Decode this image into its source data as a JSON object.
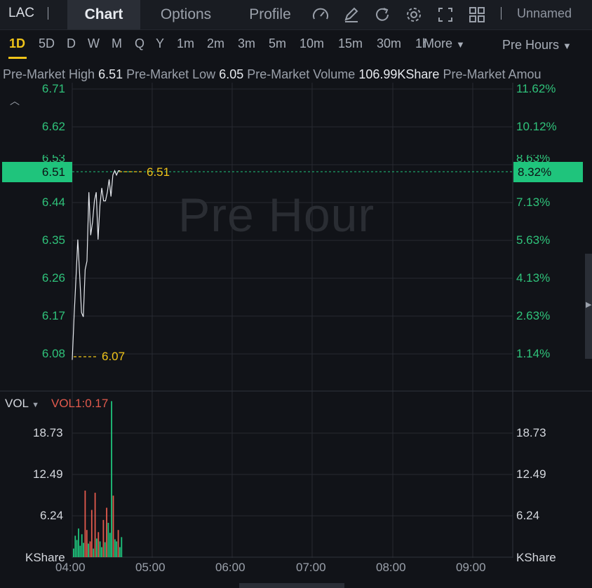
{
  "symbol": "LAC",
  "tabs": [
    "Chart",
    "Options",
    "Profile"
  ],
  "toolbar_icons": [
    "gauge-icon",
    "edit-icon",
    "refresh-icon",
    "settings-icon",
    "fullscreen-icon",
    "layout-grid-icon"
  ],
  "layout_name": "Unnamed",
  "periods": [
    "1D",
    "5D",
    "D",
    "W",
    "M",
    "Q",
    "Y",
    "1m",
    "2m",
    "3m",
    "5m",
    "10m",
    "15m",
    "30m",
    "1h"
  ],
  "more_label": "More",
  "session_label": "Pre Hours",
  "stats": {
    "high_label": "Pre-Market High",
    "high_value": "6.51",
    "low_label": "Pre-Market Low",
    "low_value": "6.05",
    "volume_label": "Pre-Market Volume",
    "volume_value": "106.99KShare",
    "amount_label": "Pre-Market Amou"
  },
  "watermark": "Pre Hour",
  "price_axis": [
    "6.71",
    "6.62",
    "6.53",
    "6.44",
    "6.35",
    "6.26",
    "6.17",
    "6.08"
  ],
  "pct_axis": [
    "11.62%",
    "10.12%",
    "8.63%",
    "7.13%",
    "5.63%",
    "4.13%",
    "2.63%",
    "1.14%"
  ],
  "current_price": "6.51",
  "current_pct": "8.32%",
  "last_label": "6.51",
  "open_label": "6.07",
  "volume": {
    "indicator": "VOL",
    "value_label": "VOL1:0.17",
    "axis": [
      "18.73",
      "12.49",
      "6.24"
    ],
    "unit": "KShare"
  },
  "time_axis": [
    "04:00",
    "05:00",
    "06:00",
    "07:00",
    "08:00",
    "09:00"
  ],
  "colors": {
    "up": "#1fc47c",
    "down": "#e25a4d",
    "accent": "#f0c419"
  },
  "chart_data": {
    "type": "line",
    "price_series": [
      6.07,
      6.17,
      6.26,
      6.35,
      6.27,
      6.18,
      6.17,
      6.28,
      6.3,
      6.46,
      6.36,
      6.39,
      6.44,
      6.46,
      6.35,
      6.43,
      6.47,
      6.44,
      6.44,
      6.46,
      6.49,
      6.45,
      6.5,
      6.51,
      6.5,
      6.51,
      6.51
    ],
    "ylim": [
      6.03,
      6.71
    ],
    "volume_values": [
      1.2,
      3.0,
      2.4,
      4.0,
      1.6,
      3.2,
      2.0,
      9.3,
      3.8,
      1.9,
      2.2,
      6.6,
      1.2,
      9.0,
      2.6,
      3.5,
      2.2,
      1.4,
      5.2,
      2.1,
      6.9,
      4.8,
      3.4,
      21.8,
      8.6,
      2.5,
      2.2,
      3.8,
      1.4,
      2.8
    ],
    "volume_up": [
      true,
      true,
      true,
      true,
      true,
      true,
      true,
      false,
      false,
      true,
      false,
      false,
      true,
      false,
      true,
      false,
      true,
      true,
      false,
      true,
      false,
      true,
      true,
      true,
      false,
      true,
      true,
      false,
      true,
      true
    ],
    "volume_ylim": [
      0,
      23.5
    ]
  }
}
